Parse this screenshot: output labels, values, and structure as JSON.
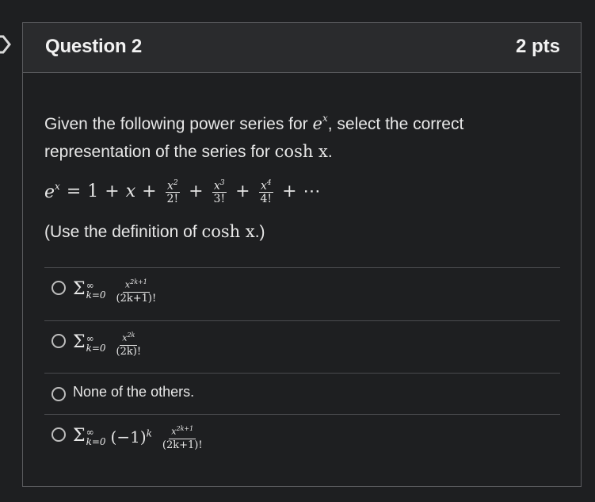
{
  "question": {
    "title": "Question 2",
    "points": "2 pts"
  },
  "prompt": {
    "line1": "Given the following power series for",
    "line1_math": "e",
    "line1_math_sup": "x",
    "line1_tail": ", select the correct",
    "line2": "representation of the series for",
    "line2_math": "cosh x",
    "line2_tail": "."
  },
  "formula": {
    "lhs_base": "e",
    "lhs_sup": "x",
    "eq": "=",
    "term1": "1",
    "plus": "+",
    "term2": "x",
    "fractions": [
      {
        "num": "x2",
        "den": "2!"
      },
      {
        "num": "x3",
        "den": "3!"
      },
      {
        "num": "x4",
        "den": "4!"
      }
    ],
    "ellipsis": "⋯"
  },
  "note": {
    "text": "(Use the definition of",
    "math": "cosh x",
    "tail": ".)"
  },
  "answers": [
    {
      "sigma": "Σ",
      "upper": "∞",
      "lower": "k=0",
      "sign": "",
      "num": "x2k+1",
      "den": "(2k+1)!"
    },
    {
      "sigma": "Σ",
      "upper": "∞",
      "lower": "k=0",
      "sign": "",
      "num": "x2k",
      "den": "(2k)!"
    },
    {
      "text": "None of the others."
    },
    {
      "sigma": "Σ",
      "upper": "∞",
      "lower": "k=0",
      "sign": "(−1)k",
      "num": "x2k+1",
      "den": "(2k+1)!"
    }
  ]
}
